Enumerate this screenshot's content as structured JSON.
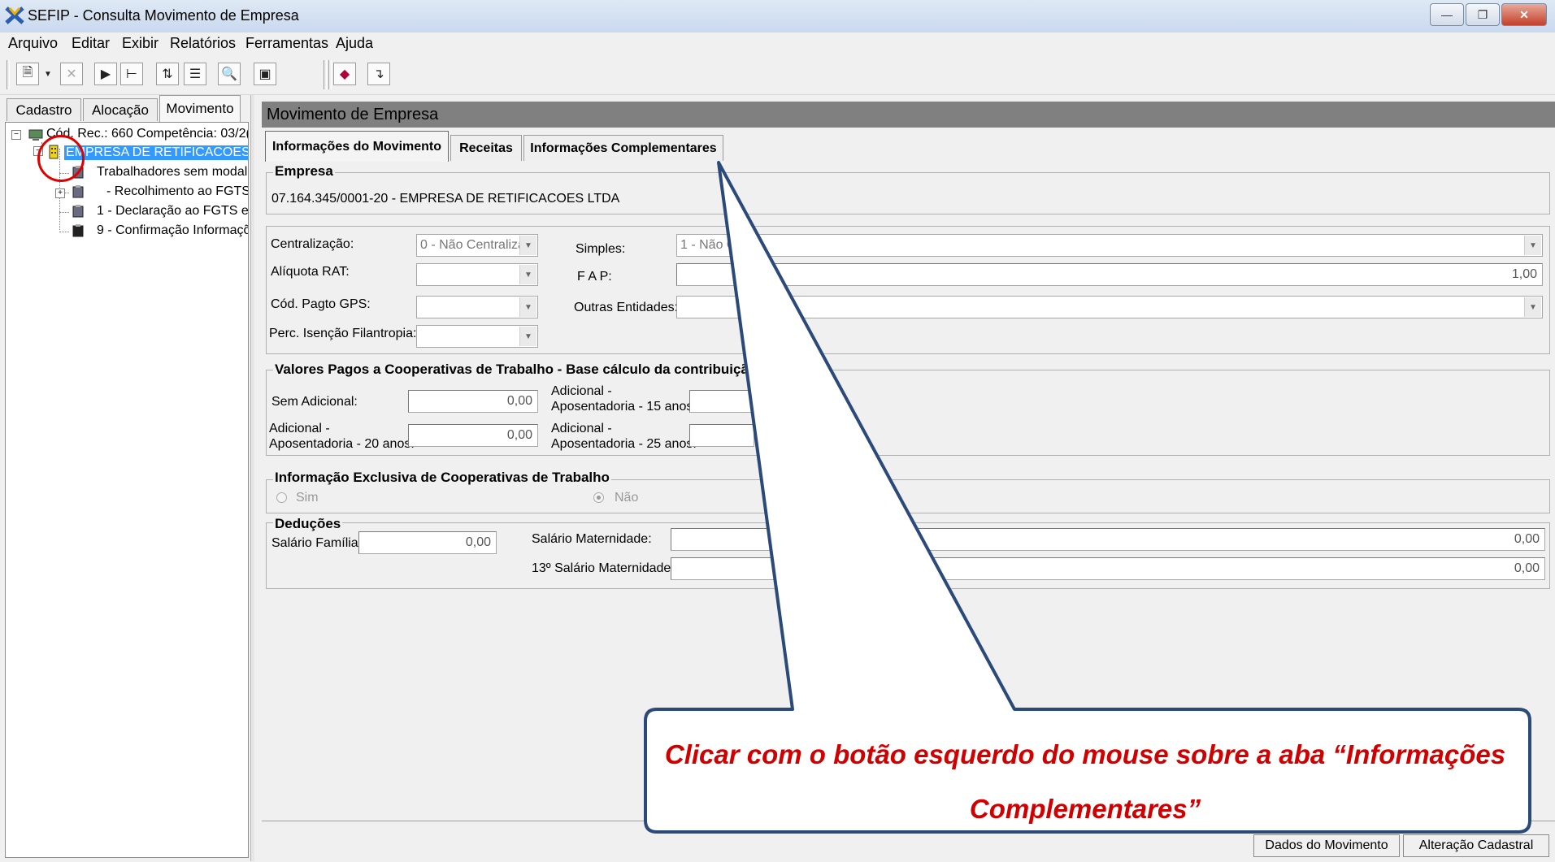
{
  "window": {
    "title": "SEFIP - Consulta Movimento de Empresa"
  },
  "menu": [
    "Arquivo",
    "Editar",
    "Exibir",
    "Relatórios",
    "Ferramentas",
    "Ajuda"
  ],
  "left_tabs": [
    "Cadastro",
    "Alocação",
    "Movimento"
  ],
  "tree": {
    "root": "Cód. Rec.: 660 Competência: 03/2(",
    "company": "EMPRESA DE RETIFICACOES",
    "items": [
      "Trabalhadores sem modalid",
      "- Recolhimento ao FGTS",
      "1 - Declaração ao FGTS e",
      "9 - Confirmação Informaçõe"
    ]
  },
  "panel": {
    "title": "Movimento de Empresa"
  },
  "tabs": [
    "Informações do Movimento",
    "Receitas",
    "Informações Complementares"
  ],
  "empresa": {
    "label": "Empresa",
    "value": "07.164.345/0001-20 -  EMPRESA DE RETIFICACOES LTDA"
  },
  "params": {
    "centralizacao_label": "Centralização:",
    "centralizacao_value": "0 - Não Centraliza",
    "simples_label": "Simples:",
    "simples_value": "1 - Não O",
    "aliquota_label": "Alíquota RAT:",
    "fap_label": "F A P:",
    "fap_value": "1,00",
    "cod_gps_label": "Cód. Pagto GPS:",
    "outras_label": "Outras Entidades:",
    "perc_label": "Perc. Isenção Filantropia:"
  },
  "cooperativas": {
    "title": "Valores Pagos a Cooperativas de Trabalho - Base cálculo da contribuiçã",
    "sem_adicional_label": "Sem Adicional:",
    "sem_adicional_value": "0,00",
    "ad15_label_1": "Adicional -",
    "ad15_label_2": "Aposentadoria - 15 anos:",
    "ad20_label_1": "Adicional -",
    "ad20_label_2": "Aposentadoria - 20 anos:",
    "ad20_value": "0,00",
    "ad25_label_1": "Adicional -",
    "ad25_label_2": "Aposentadoria - 25 anos:"
  },
  "exclusiva": {
    "title": "Informação Exclusiva de Cooperativas de Trabalho",
    "sim": "Sim",
    "nao": "Não",
    "selected": "Não"
  },
  "deducoes": {
    "title": "Deduções",
    "salario_familia_label": "Salário Família:",
    "salario_familia_value": "0,00",
    "salario_maternidade_label": "Salário Maternidade:",
    "salario_maternidade_value": "0,00",
    "decimo_label": "13º Salário Maternidade:",
    "decimo_value": "0,00"
  },
  "buttons": {
    "dados": "Dados do Movimento",
    "alteracao": "Alteração Cadastral"
  },
  "callout": {
    "line1": "Clicar com o botão esquerdo do mouse sobre a aba “Informações",
    "line2": "Complementares”"
  },
  "colors": {
    "callout_border": "#2b4a7a",
    "callout_text": "#d00000",
    "selection": "#3399ff",
    "header": "#808080"
  }
}
